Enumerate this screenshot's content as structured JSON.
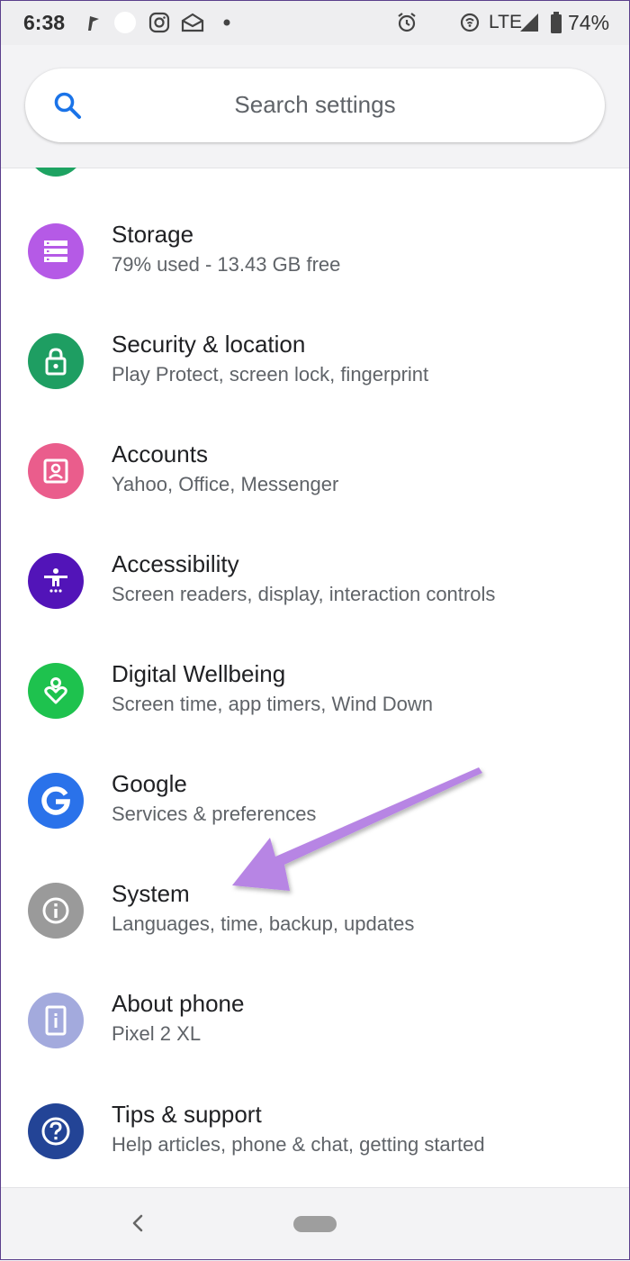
{
  "status_bar": {
    "time": "6:38",
    "network": "LTE",
    "battery": "74%",
    "icons": [
      "flag-icon",
      "circle-notification-icon",
      "instagram-icon",
      "mail-icon",
      "dot-icon",
      "alarm-icon",
      "wifi-calling-icon",
      "signal-icon",
      "battery-icon"
    ]
  },
  "search": {
    "placeholder": "Search settings",
    "icon": "search-icon"
  },
  "settings": {
    "items": [
      {
        "title": "Storage",
        "subtitle": "79% used - 13.43 GB free",
        "color": "#b55ae6",
        "icon": "storage-icon"
      },
      {
        "title": "Security & location",
        "subtitle": "Play Protect, screen lock, fingerprint",
        "color": "#1e9e62",
        "icon": "lock-icon"
      },
      {
        "title": "Accounts",
        "subtitle": "Yahoo, Office, Messenger",
        "color": "#ea5d8c",
        "icon": "account-icon"
      },
      {
        "title": "Accessibility",
        "subtitle": "Screen readers, display, interaction controls",
        "color": "#5214b8",
        "icon": "accessibility-icon"
      },
      {
        "title": "Digital Wellbeing",
        "subtitle": "Screen time, app timers, Wind Down",
        "color": "#1ec24e",
        "icon": "wellbeing-icon"
      },
      {
        "title": "Google",
        "subtitle": "Services & preferences",
        "color": "#2a72ea",
        "icon": "google-icon"
      },
      {
        "title": "System",
        "subtitle": "Languages, time, backup, updates",
        "color": "#9a9a9a",
        "icon": "info-icon"
      },
      {
        "title": "About phone",
        "subtitle": "Pixel 2 XL",
        "color": "#a3aadd",
        "icon": "phone-info-icon"
      },
      {
        "title": "Tips & support",
        "subtitle": "Help articles, phone & chat, getting started",
        "color": "#234496",
        "icon": "help-icon"
      }
    ]
  },
  "annotation": {
    "color": "#b785e4",
    "icon": "arrow-annotation"
  },
  "nav_bar": {
    "back_icon": "back-chevron-icon",
    "home_icon": "home-pill-icon"
  }
}
